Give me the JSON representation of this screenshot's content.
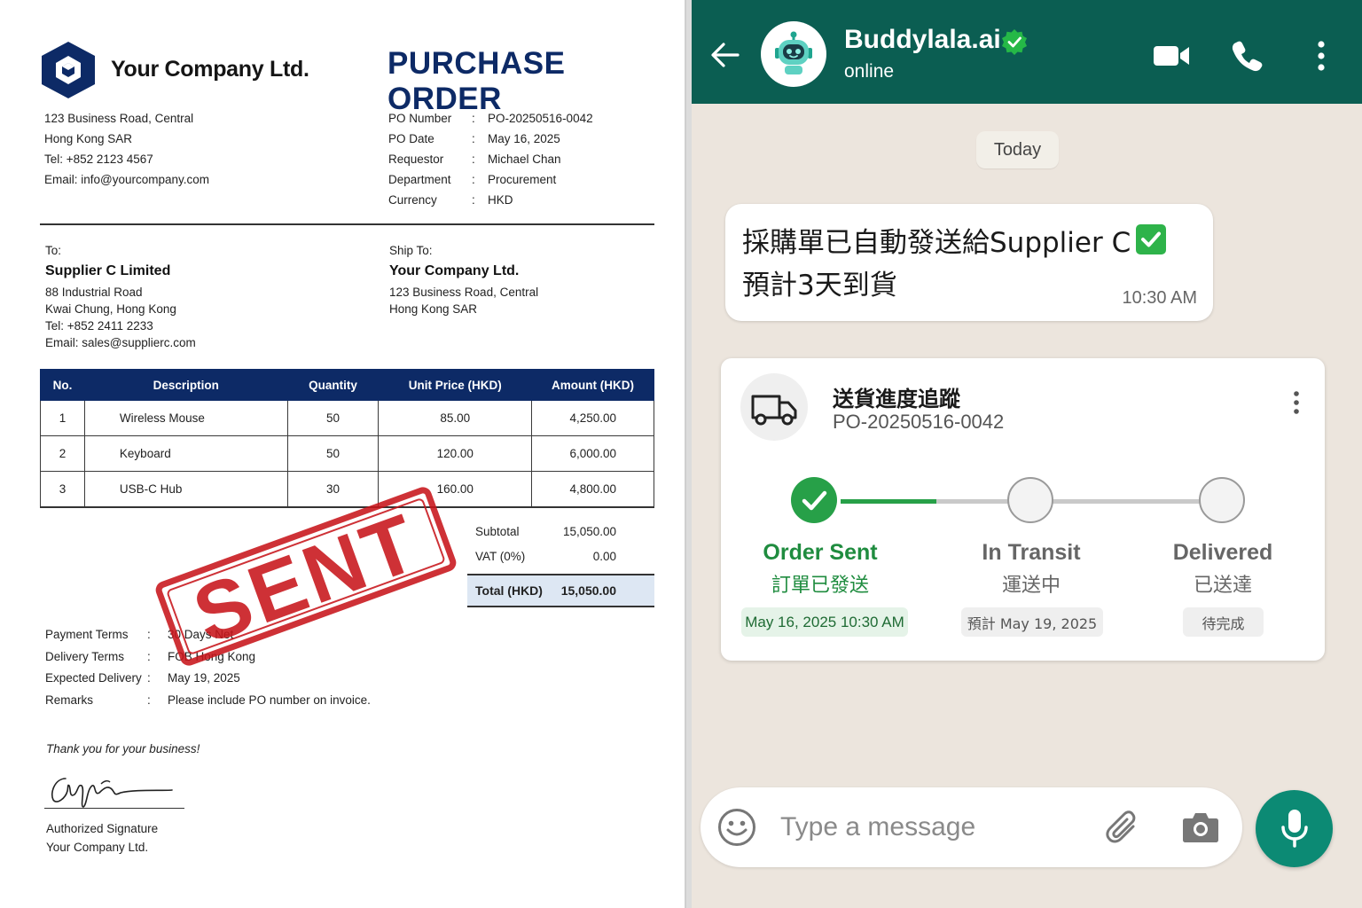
{
  "po": {
    "company_name": "Your Company Ltd.",
    "title": "PURCHASE ORDER",
    "address": [
      "123 Business Road, Central",
      "Hong Kong SAR",
      "Tel: +852 2123 4567",
      "Email: info@yourcompany.com"
    ],
    "meta": [
      {
        "label": "PO Number",
        "value": "PO-20250516-0042"
      },
      {
        "label": "PO Date",
        "value": "May 16, 2025"
      },
      {
        "label": "Requestor",
        "value": "Michael Chan"
      },
      {
        "label": "Department",
        "value": "Procurement"
      },
      {
        "label": "Currency",
        "value": "HKD"
      }
    ],
    "to": {
      "heading": "To:",
      "name": "Supplier C Limited",
      "lines": [
        "88 Industrial Road",
        "Kwai Chung, Hong Kong",
        "Tel: +852 2411 2233",
        "Email: sales@supplierc.com"
      ]
    },
    "ship_to": {
      "heading": "Ship To:",
      "name": "Your Company Ltd.",
      "lines": [
        "123 Business Road, Central",
        "Hong Kong SAR"
      ]
    },
    "table": {
      "headers": [
        "No.",
        "Description",
        "Quantity",
        "Unit Price (HKD)",
        "Amount (HKD)"
      ],
      "rows": [
        [
          "1",
          "Wireless Mouse",
          "50",
          "85.00",
          "4,250.00"
        ],
        [
          "2",
          "Keyboard",
          "50",
          "120.00",
          "6,000.00"
        ],
        [
          "3",
          "USB-C Hub",
          "30",
          "160.00",
          "4,800.00"
        ]
      ]
    },
    "totals": {
      "subtotal_label": "Subtotal",
      "subtotal": "15,050.00",
      "vat_label": "VAT (0%)",
      "vat": "0.00",
      "total_label": "Total (HKD)",
      "total": "15,050.00"
    },
    "terms": [
      {
        "label": "Payment Terms",
        "value": "30 Days Net"
      },
      {
        "label": "Delivery Terms",
        "value": "FOB Hong Kong"
      },
      {
        "label": "Expected Delivery",
        "value": "May 19, 2025"
      },
      {
        "label": "Remarks",
        "value": "Please include PO number on invoice."
      }
    ],
    "thanks": "Thank you for your business!",
    "signature_label": "Authorized Signature",
    "signature_company": "Your Company Ltd.",
    "stamp": "SENT",
    "stamp_color": "#c8151b",
    "brand_color": "#0d2a66"
  },
  "chat": {
    "contact_name": "Buddylala.ai",
    "status": "online",
    "date_chip": "Today",
    "message": {
      "line1": "採購單已自動發送給Supplier C",
      "line2": "預計3天到貨",
      "time": "10:30 AM",
      "emoji": "check-mark-button"
    },
    "tracking": {
      "title": "送貨進度追蹤",
      "po_number": "PO-20250516-0042",
      "progress": 0.25,
      "steps": [
        {
          "en": "Order Sent",
          "zh": "訂單已發送",
          "chip": "May 16, 2025 10:30 AM",
          "state": "done"
        },
        {
          "en": "In Transit",
          "zh": "運送中",
          "chip": "預計 May 19, 2025",
          "state": "pending"
        },
        {
          "en": "Delivered",
          "zh": "已送達",
          "chip": "待完成",
          "state": "pending"
        }
      ]
    },
    "input_placeholder": "Type a message",
    "header_color": "#0b5e52",
    "accent_green": "#27a048",
    "mic_color": "#0c8a74"
  }
}
